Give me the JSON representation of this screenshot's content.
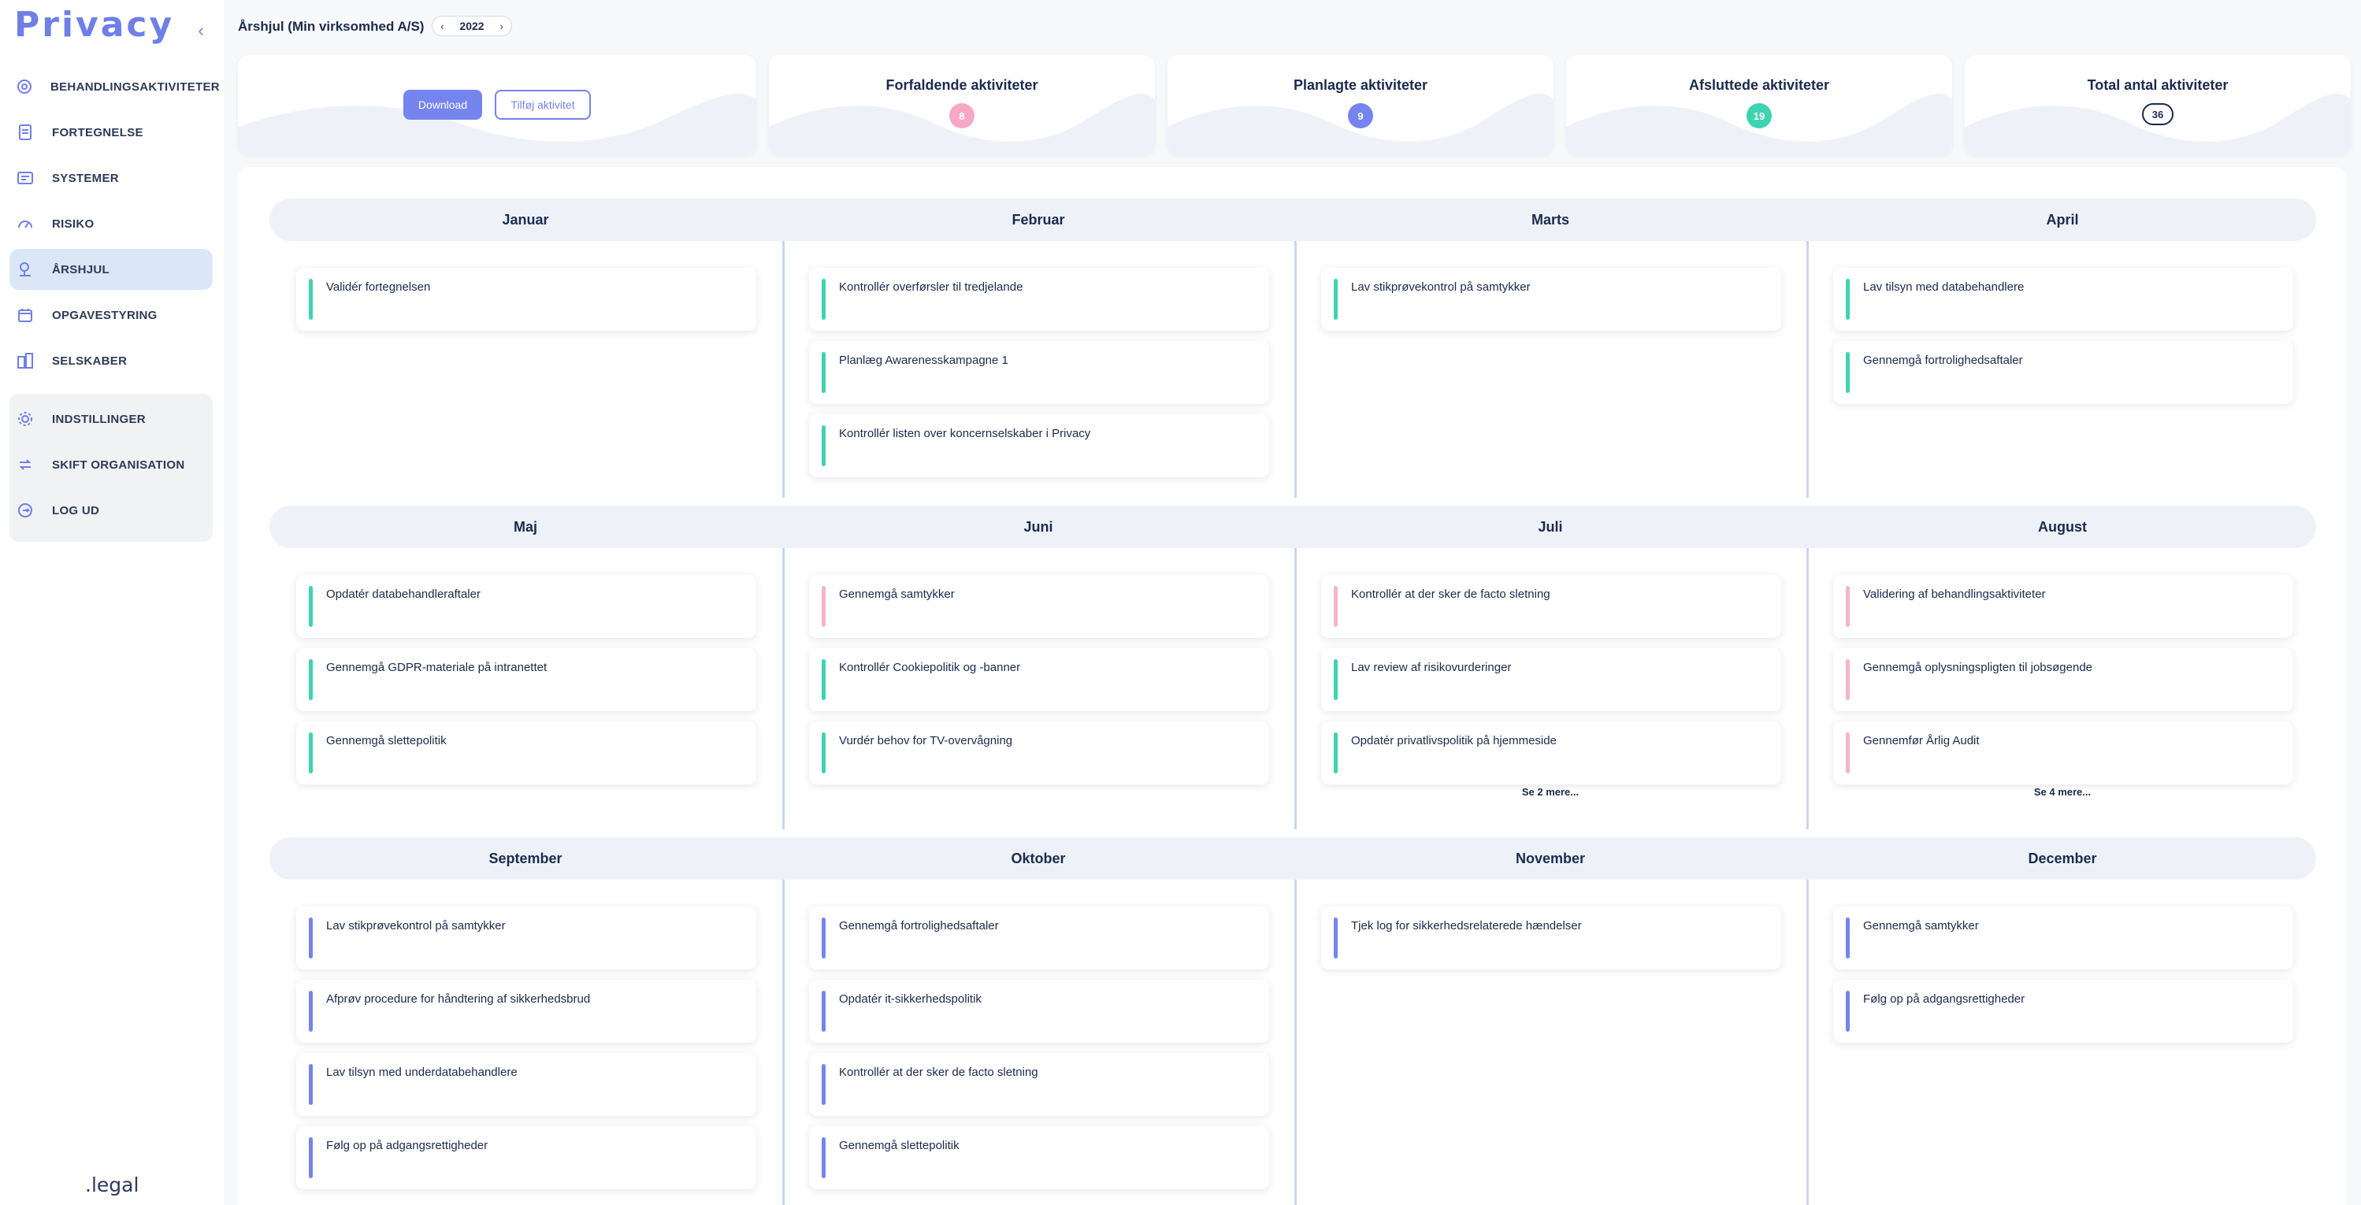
{
  "app": {
    "logo": "Privacy",
    "brand": ".legal"
  },
  "sidebar": {
    "items": [
      {
        "label": "BEHANDLINGSAKTIVITETER",
        "icon": "processing-icon"
      },
      {
        "label": "FORTEGNELSE",
        "icon": "document-icon"
      },
      {
        "label": "SYSTEMER",
        "icon": "systems-icon"
      },
      {
        "label": "RISIKO",
        "icon": "gauge-icon"
      },
      {
        "label": "ÅRSHJUL",
        "icon": "year-wheel-icon",
        "active": true
      },
      {
        "label": "OPGAVESTYRING",
        "icon": "calendar-icon"
      },
      {
        "label": "SELSKABER",
        "icon": "buildings-icon"
      }
    ],
    "settings": [
      {
        "label": "INDSTILLINGER",
        "icon": "gear-icon"
      },
      {
        "label": "SKIFT ORGANISATION",
        "icon": "switch-icon"
      },
      {
        "label": "LOG UD",
        "icon": "logout-icon"
      }
    ]
  },
  "header": {
    "title": "Årshjul (Min virksomhed A/S)",
    "year": "2022"
  },
  "actions": {
    "download": "Download",
    "add": "Tilføj aktivitet"
  },
  "stats": [
    {
      "label": "Forfaldende aktiviteter",
      "value": "8",
      "color": "#f7a8c5"
    },
    {
      "label": "Planlagte aktiviteter",
      "value": "9",
      "color": "#7584ee"
    },
    {
      "label": "Afsluttede aktiviteter",
      "value": "19",
      "color": "#3ed3b0"
    },
    {
      "label": "Total antal aktiviteter",
      "value": "36",
      "color": "#ffffff"
    }
  ],
  "colors": {
    "green": "#3ed3b0",
    "pink": "#f7b3cc",
    "blue": "#7584ee"
  },
  "months": [
    {
      "name": "Januar",
      "tasks": [
        {
          "t": "Validér fortegnelsen",
          "c": "green"
        }
      ]
    },
    {
      "name": "Februar",
      "tasks": [
        {
          "t": "Kontrollér overførsler til tredjelande",
          "c": "green"
        },
        {
          "t": "Planlæg Awarenesskampagne 1",
          "c": "green"
        },
        {
          "t": "Kontrollér listen over koncernselskaber i Privacy",
          "c": "green"
        }
      ]
    },
    {
      "name": "Marts",
      "tasks": [
        {
          "t": "Lav stikprøvekontrol på samtykker",
          "c": "green"
        }
      ]
    },
    {
      "name": "April",
      "tasks": [
        {
          "t": "Lav tilsyn med databehandlere",
          "c": "green"
        },
        {
          "t": "Gennemgå fortrolighedsaftaler",
          "c": "green"
        }
      ]
    },
    {
      "name": "Maj",
      "tasks": [
        {
          "t": "Opdatér databehandleraftaler",
          "c": "green"
        },
        {
          "t": "Gennemgå GDPR-materiale på intranettet",
          "c": "green"
        },
        {
          "t": "Gennemgå slettepolitik",
          "c": "green"
        }
      ]
    },
    {
      "name": "Juni",
      "tasks": [
        {
          "t": "Gennemgå samtykker",
          "c": "pink"
        },
        {
          "t": "Kontrollér Cookiepolitik og -banner",
          "c": "green"
        },
        {
          "t": "Vurdér behov for TV-overvågning",
          "c": "green"
        }
      ]
    },
    {
      "name": "Juli",
      "tasks": [
        {
          "t": "Kontrollér at der sker de facto sletning",
          "c": "pink"
        },
        {
          "t": "Lav review af risikovurderinger",
          "c": "green"
        },
        {
          "t": "Opdatér privatlivspolitik på hjemmeside",
          "c": "green"
        }
      ],
      "more": "Se 2 mere..."
    },
    {
      "name": "August",
      "tasks": [
        {
          "t": "Validering af behandlingsaktiviteter",
          "c": "pink"
        },
        {
          "t": "Gennemgå oplysningspligten til jobsøgende",
          "c": "pink"
        },
        {
          "t": "Gennemfør Årlig Audit",
          "c": "pink"
        }
      ],
      "more": "Se 4 mere..."
    },
    {
      "name": "September",
      "tasks": [
        {
          "t": "Lav stikprøvekontrol på samtykker",
          "c": "blue"
        },
        {
          "t": "Afprøv procedure for håndtering af sikkerhedsbrud",
          "c": "blue"
        },
        {
          "t": "Lav tilsyn med underdatabehandlere",
          "c": "blue"
        },
        {
          "t": "Følg op på adgangsrettigheder",
          "c": "blue"
        }
      ]
    },
    {
      "name": "Oktober",
      "tasks": [
        {
          "t": "Gennemgå fortrolighedsaftaler",
          "c": "blue"
        },
        {
          "t": "Opdatér it-sikkerhedspolitik",
          "c": "blue"
        },
        {
          "t": "Kontrollér at der sker de facto sletning",
          "c": "blue"
        },
        {
          "t": "Gennemgå slettepolitik",
          "c": "blue"
        }
      ]
    },
    {
      "name": "November",
      "tasks": [
        {
          "t": "Tjek log for sikkerhedsrelaterede hændelser",
          "c": "blue"
        }
      ]
    },
    {
      "name": "December",
      "tasks": [
        {
          "t": "Gennemgå samtykker",
          "c": "blue"
        },
        {
          "t": "Følg op på adgangsrettigheder",
          "c": "blue"
        }
      ]
    }
  ]
}
